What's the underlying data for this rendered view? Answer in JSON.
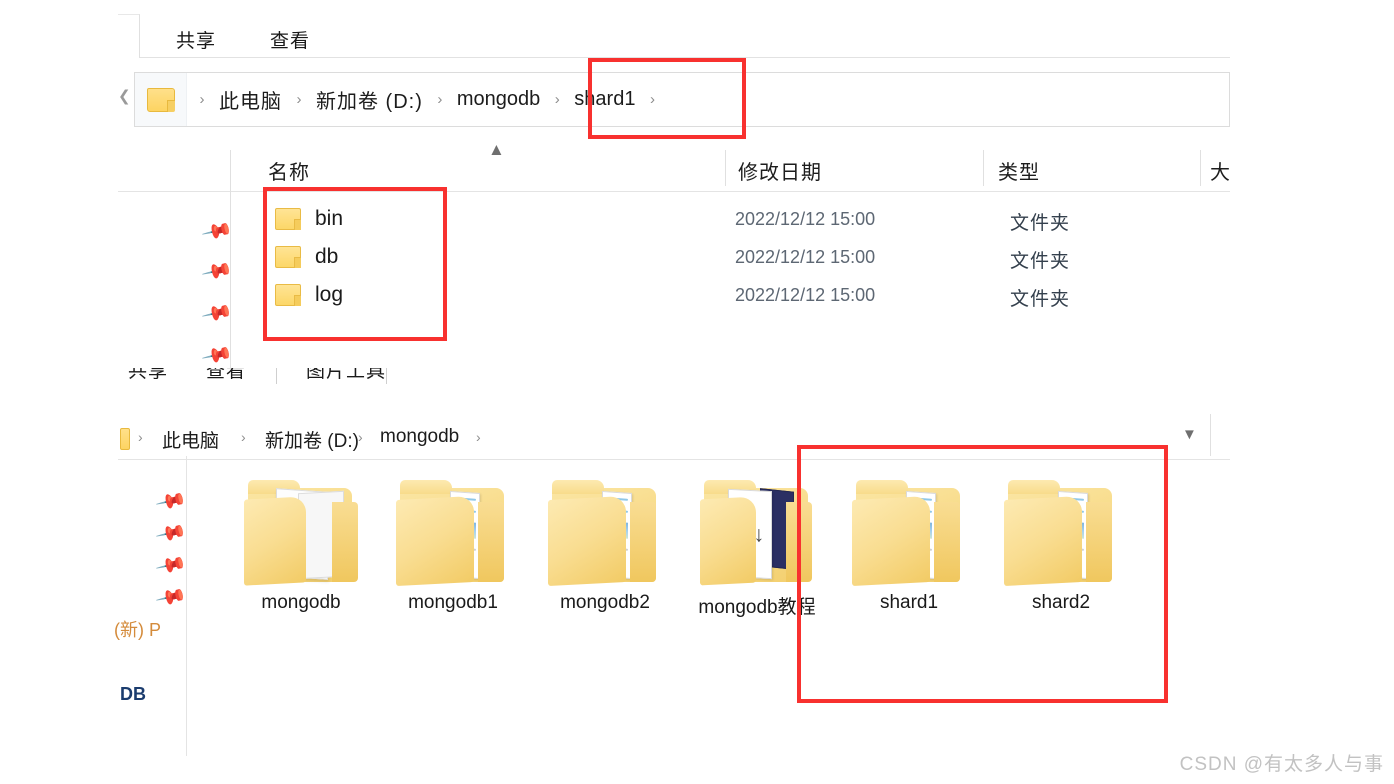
{
  "upper_window": {
    "ribbon_tabs": [
      {
        "label": "共享",
        "name": "tab-share"
      },
      {
        "label": "查看",
        "name": "tab-view"
      }
    ],
    "address_bar": {
      "back_chevron": "chevron-left-icon",
      "folder_icon": "folder-icon",
      "separator": "›",
      "crumbs": [
        {
          "label": "此电脑"
        },
        {
          "label": "新加卷 (D:)"
        },
        {
          "label": "mongodb"
        },
        {
          "label": "shard1"
        }
      ],
      "trailing_separator": "›"
    },
    "columns": [
      {
        "label": "名称"
      },
      {
        "label": "修改日期"
      },
      {
        "label": "类型"
      },
      {
        "label": "大"
      }
    ],
    "sort_indicator": "caret-up-icon",
    "files": [
      {
        "name": "bin",
        "date_modified": "2022/12/12 15:00",
        "type": "文件夹"
      },
      {
        "name": "db",
        "date_modified": "2022/12/12 15:00",
        "type": "文件夹"
      },
      {
        "name": "log",
        "date_modified": "2022/12/12 15:00",
        "type": "文件夹"
      }
    ],
    "nav_pins": 4
  },
  "lower_window": {
    "ribbon_tabs": [
      {
        "label": "共享",
        "name": "tab-share"
      },
      {
        "label": "查看",
        "name": "tab-view"
      },
      {
        "label": "图片工具",
        "name": "tab-picture-tools"
      }
    ],
    "address_bar": {
      "folder_icon": "folder-icon",
      "separator": "›",
      "crumbs": [
        {
          "label": "此电脑"
        },
        {
          "label": "新加卷 (D:)"
        },
        {
          "label": "mongodb"
        }
      ],
      "trailing_separator": "›",
      "dropdown_icon": "chevron-down-icon"
    },
    "nav_pins": 4,
    "nav_partial_labels": [
      {
        "label": "(新) P"
      },
      {
        "label": "DB"
      }
    ],
    "tiles": [
      {
        "label": "mongodb",
        "icon": "folder-documents-icon"
      },
      {
        "label": "mongodb1",
        "icon": "folder-pictures-icon"
      },
      {
        "label": "mongodb2",
        "icon": "folder-pictures-icon"
      },
      {
        "label": "mongodb教程",
        "icon": "folder-markdown-icon"
      },
      {
        "label": "shard1",
        "icon": "folder-pictures-icon"
      },
      {
        "label": "shard2",
        "icon": "folder-pictures-icon"
      }
    ]
  },
  "annotations": {
    "accent_color": "#f8312f",
    "boxes": [
      {
        "name": "highlight-breadcrumb-shard1"
      },
      {
        "name": "highlight-folder-list-bin-db-log"
      },
      {
        "name": "highlight-shard-folders"
      }
    ]
  },
  "watermark": {
    "text": "CSDN @有太多人与事"
  }
}
